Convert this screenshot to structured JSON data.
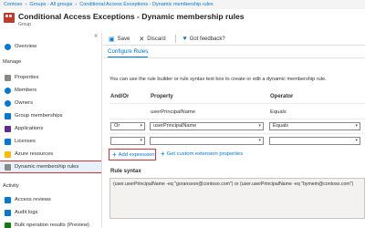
{
  "breadcrumb": [
    "Contoso",
    "Groups - All groups",
    "Conditional Access Exceptions - Dynamic membership rules"
  ],
  "header": {
    "title": "Conditional Access Exceptions - Dynamic membership rules",
    "subtitle": "Group"
  },
  "sidebar": {
    "collapse": "«",
    "overview": "Overview",
    "manage_label": "Manage",
    "manage_items": [
      "Properties",
      "Members",
      "Owners",
      "Group memberships",
      "Applications",
      "Licenses",
      "Azure resources",
      "Dynamic membership rules"
    ],
    "activity_label": "Activity",
    "activity_items": [
      "Access reviews",
      "Audit logs",
      "Bulk operation results (Preview)"
    ]
  },
  "toolbar": {
    "save": "Save",
    "discard": "Discard",
    "feedback": "Got feedback?"
  },
  "tab": "Configure Rules",
  "intro": "You can use the rule builder or rule syntax text box to create or edit a dynamic membership rule.",
  "table": {
    "headers": [
      "And/Or",
      "Property",
      "Operator"
    ],
    "rows": [
      {
        "andor": "",
        "property": "userPrincipalName",
        "operator": "Equals"
      },
      {
        "andor": "Or",
        "property": "userPrincipalName",
        "operator": "Equals"
      },
      {
        "andor": "",
        "property": "",
        "operator": ""
      }
    ]
  },
  "add_expression": "Add expression",
  "extension_link": "Get custom extension properties",
  "rule_syntax_label": "Rule syntax",
  "rule_syntax": "(user.userPrincipalName -eq \"goransson@contoso.com\") or (user.userPrincipalName -eq \"bymem@contoso.com\")",
  "colors": {
    "accent": "#0078d4",
    "highlight_border": "#d13438",
    "group_icon": "#c0392b"
  }
}
